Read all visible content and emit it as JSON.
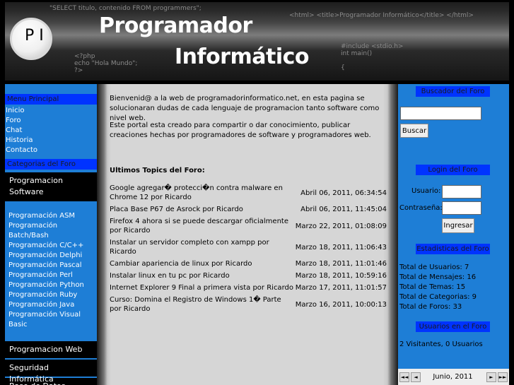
{
  "header": {
    "logo_letters": "P I",
    "title_line1": "Programador",
    "title_line2": "Informático",
    "code_snippets": [
      "\"SELECT titulo, contenido FROM programmers\";",
      "<html> <title>Programador Informático</title> </html>",
      "<?php\necho \"Hola Mundo\";\n?>",
      "#include <stdio.h>\nint main()\n\n{"
    ]
  },
  "left": {
    "menu_title": "Menu Principal",
    "menu_items": [
      "Inicio",
      "Foro",
      "Chat",
      "Historia",
      "Contacto"
    ],
    "categories_title": "Categorias del Foro",
    "category_software": "Programacion Software",
    "languages": [
      "Programación ASM",
      "Programación Batch/Bash",
      "Programación C/C++",
      "Programación Delphi",
      "Programación Pascal",
      "Programación Perl",
      "Programación Python",
      "Programación Ruby",
      "Programación Java",
      "Programación Visual Basic"
    ],
    "category_web": "Programacion Web",
    "category_security": "Seguridad Informática",
    "category_db": "Base de Datos"
  },
  "main": {
    "intro1": "Bienvenid@ a la web de programadorinformatico.net, en esta pagina se solucionaran dudas de cada lenguaje de programacion tanto software como nivel web.",
    "intro2": "Este portal esta creado para compartir o dar conocimiento, publicar creaciones hechas por programadores de software y programadores web.",
    "topics_title": "Ultimos Topics del Foro:",
    "topics": [
      {
        "title": "Google agregar� protecci�n contra malware en Chrome 12 por Ricardo",
        "date": "Abril 06, 2011, 06:34:54"
      },
      {
        "title": "Placa Base P67 de Asrock por Ricardo",
        "date": "Abril 06, 2011, 11:45:04"
      },
      {
        "title": "Firefox 4 ahora si se puede descargar oficialmente por Ricardo",
        "date": "Marzo 22, 2011, 01:08:09"
      },
      {
        "title": "Instalar un servidor completo con xampp por Ricardo",
        "date": "Marzo 18, 2011, 11:06:43"
      },
      {
        "title": "Cambiar apariencia de linux por Ricardo",
        "date": "Marzo 18, 2011, 11:01:46"
      },
      {
        "title": "Instalar linux en tu pc por Ricardo",
        "date": "Marzo 18, 2011, 10:59:16"
      },
      {
        "title": "Internet Explorer 9 Final a primera vista por Ricardo",
        "date": "Marzo 17, 2011, 11:01:57"
      },
      {
        "title": "Curso: Domina el Registro de Windows 1� Parte por Ricardo",
        "date": "Marzo 16, 2011, 10:00:13"
      }
    ]
  },
  "right": {
    "search_title": "Buscador del Foro",
    "search_value": "",
    "search_button": "Buscar",
    "login_title": "Login del Foro",
    "user_label": "Usuario:",
    "user_value": "",
    "pass_label": "Contraseña:",
    "pass_value": "",
    "login_button": "Ingresar",
    "stats_title": "Estadisticas del Foro",
    "stats": [
      "Total de Usuarios: 7",
      "Total de Mensajes: 16",
      "Total de Temas: 15",
      "Total de Categorias: 9",
      "Total de Foros: 33"
    ],
    "online_title": "Usuarios en el Foro",
    "online_text": "2 Visitantes, 0 Usuarios",
    "calendar_prev_year": "◄◄",
    "calendar_prev": "◄",
    "calendar_month": "Junio, 2011",
    "calendar_next": "►",
    "calendar_next_year": "►►"
  },
  "colors": {
    "sidebar_blue": "#1e7ed6",
    "heading_blue": "#0033ff",
    "content_gray": "#d6d6d6"
  }
}
